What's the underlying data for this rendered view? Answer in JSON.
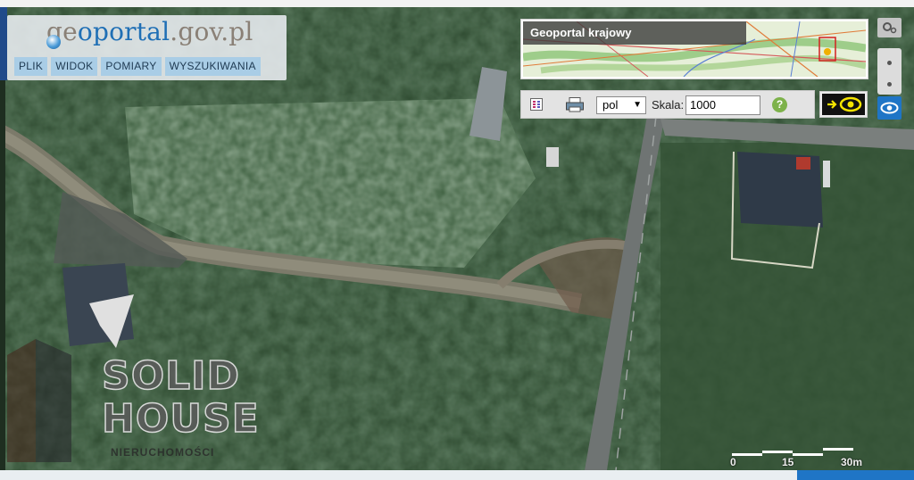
{
  "logo": {
    "part1": "ge",
    "part2": "oportal",
    "part3": ".gov.pl"
  },
  "menu": {
    "items": [
      {
        "label": "PLIK"
      },
      {
        "label": "WIDOK"
      },
      {
        "label": "POMIARY"
      },
      {
        "label": "WYSZUKIWANIA"
      }
    ]
  },
  "overview": {
    "title": "Geoportal krajowy"
  },
  "toolbar": {
    "layers_icon": "layers-list-icon",
    "print_icon": "print-icon",
    "language": "pol",
    "scale_label": "Skala:",
    "scale_value": "1000",
    "help": "?"
  },
  "watermark": {
    "line1": "SOLID",
    "line2": "HOUSE",
    "line3": "NIERUCHOMOŚCI"
  },
  "scalebar": {
    "ticks": [
      "0",
      "15",
      "30m"
    ]
  },
  "colors": {
    "menu_bg": "#a9cde6",
    "accent_blue": "#1f75c6",
    "help_green": "#7db24a",
    "eye_yellow": "#f5e400"
  }
}
